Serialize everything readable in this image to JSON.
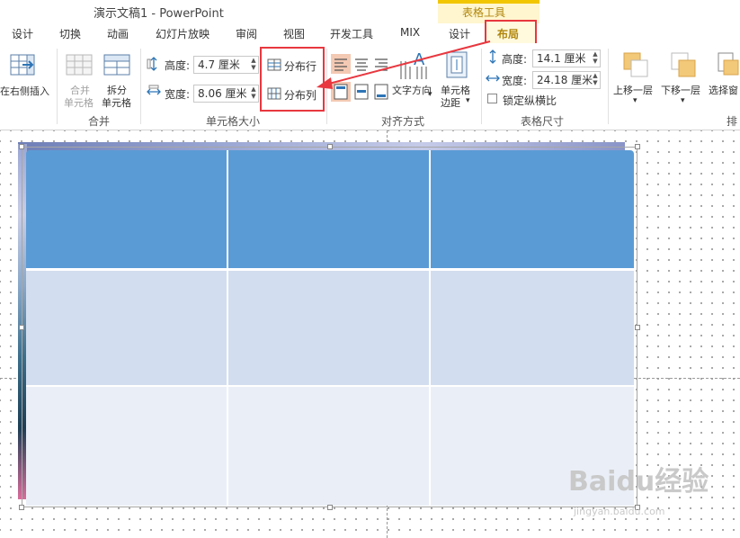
{
  "window": {
    "title": "演示文稿1 - PowerPoint"
  },
  "context_tab": {
    "label": "表格工具"
  },
  "tabs": [
    "设计",
    "切换",
    "动画",
    "幻灯片放映",
    "审阅",
    "视图",
    "开发工具",
    "MIX",
    "设计",
    "布局"
  ],
  "active_tab": "布局",
  "ribbon": {
    "insert_right_label": "在右侧插入",
    "merge": {
      "merge_cells": "合并\n单元格",
      "merge_cells_l1": "合并",
      "merge_cells_l2": "单元格",
      "split_l1": "拆分",
      "split_l2": "单元格",
      "group_label": "合并"
    },
    "cell_size": {
      "height_label": "高度:",
      "height_value": "4.7 厘米",
      "width_label": "宽度:",
      "width_value": "8.06 厘米",
      "distribute_rows": "分布行",
      "distribute_cols": "分布列",
      "group_label": "单元格大小"
    },
    "alignment": {
      "text_direction": "文字方向",
      "cell_margins_l1": "单元格",
      "cell_margins_l2": "边距",
      "group_label": "对齐方式"
    },
    "table_size": {
      "height_label": "高度:",
      "height_value": "14.1 厘米",
      "width_label": "宽度:",
      "width_value": "24.18 厘米",
      "lock_ratio": "锁定纵横比",
      "group_label": "表格尺寸"
    },
    "arrange": {
      "bring_forward": "上移一层",
      "send_backward": "下移一层",
      "selection_pane": "选择窗",
      "group_label": "排"
    }
  },
  "table": {
    "rows": 3,
    "cols": 3,
    "header_color": "#5b9bd5",
    "row2_color": "#d2deef",
    "row3_color": "#eaeff7"
  },
  "watermark": {
    "main": "Baidu经验",
    "sub": "jingyan.baidu.com"
  },
  "colors": {
    "highlight": "#e8373f",
    "accent": "#f2c600"
  }
}
